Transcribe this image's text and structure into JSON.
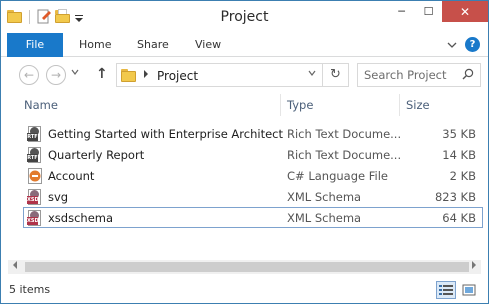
{
  "window": {
    "title": "Project",
    "minimize": "─",
    "maximize": "☐",
    "close": "✕"
  },
  "ribbon": {
    "tabs": [
      {
        "label": "File"
      },
      {
        "label": "Home"
      },
      {
        "label": "Share"
      },
      {
        "label": "View"
      }
    ],
    "help": "?"
  },
  "nav": {
    "back": "←",
    "forward": "→",
    "up": "↑",
    "breadcrumb": "Project",
    "refresh": "↻"
  },
  "search": {
    "placeholder": "Search Project"
  },
  "columns": {
    "name": "Name",
    "type": "Type",
    "size": "Size"
  },
  "files": [
    {
      "name": "Getting Started with Enterprise Architect",
      "type": "Rich Text Docume...",
      "size": "35 KB",
      "icon": "rtf-file-icon",
      "badge": "RTF"
    },
    {
      "name": "Quarterly Report",
      "type": "Rich Text Docume...",
      "size": "14 KB",
      "icon": "rtf-file-icon",
      "badge": "RTF"
    },
    {
      "name": "Account",
      "type": "C# Language File",
      "size": "2 KB",
      "icon": "csharp-file-icon",
      "badge": ""
    },
    {
      "name": "svg",
      "type": "XML Schema",
      "size": "823 KB",
      "icon": "xsd-file-icon",
      "badge": "XSD"
    },
    {
      "name": "xsdschema",
      "type": "XML Schema",
      "size": "64 KB",
      "icon": "xsd-file-icon",
      "badge": "XSD"
    }
  ],
  "status": {
    "count": "5 items"
  },
  "colors": {
    "accent": "#1979ca",
    "close": "#c7504a",
    "selection_border": "#7da2ce",
    "header_text": "#4c607a"
  }
}
